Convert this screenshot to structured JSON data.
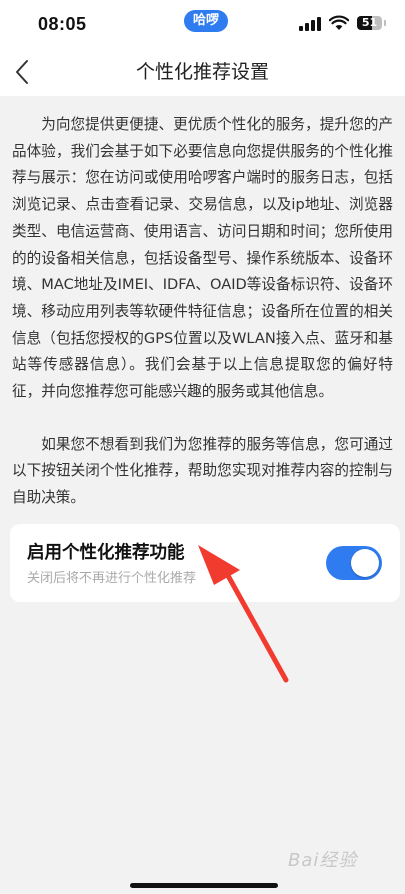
{
  "status_bar": {
    "time": "08:05",
    "app_pill": "哈啰",
    "battery": "51"
  },
  "nav": {
    "title": "个性化推荐设置",
    "back_icon": "chevron-left-icon"
  },
  "content": {
    "paragraph1": "为向您提供更便捷、更优质个性化的服务，提升您的产品体验，我们会基于如下必要信息向您提供服务的个性化推荐与展示：您在访问或使用哈啰客户端时的服务日志，包括浏览记录、点击查看记录、交易信息，以及ip地址、浏览器类型、电信运营商、使用语言、访问日期和时间；您所使用的的设备相关信息，包括设备型号、操作系统版本、设备环境、MAC地址及IMEI、IDFA、OAID等设备标识符、设备环境、移动应用列表等软硬件特征信息；设备所在位置的相关信息（包括您授权的GPS位置以及WLAN接入点、蓝牙和基站等传感器信息）。我们会基于以上信息提取您的偏好特征，并向您推荐您可能感兴趣的服务或其他信息。",
    "paragraph2": "如果您不想看到我们为您推荐的服务等信息，您可通过以下按钮关闭个性化推荐，帮助您实现对推荐内容的控制与自助决策。"
  },
  "setting": {
    "title": "启用个性化推荐功能",
    "subtitle": "关闭后将不再进行个性化推荐",
    "enabled": true
  },
  "colors": {
    "accent": "#2f7bf0",
    "annotation_arrow": "#f23b2f",
    "background": "#f2f2f2"
  },
  "watermark": "Bai经验"
}
